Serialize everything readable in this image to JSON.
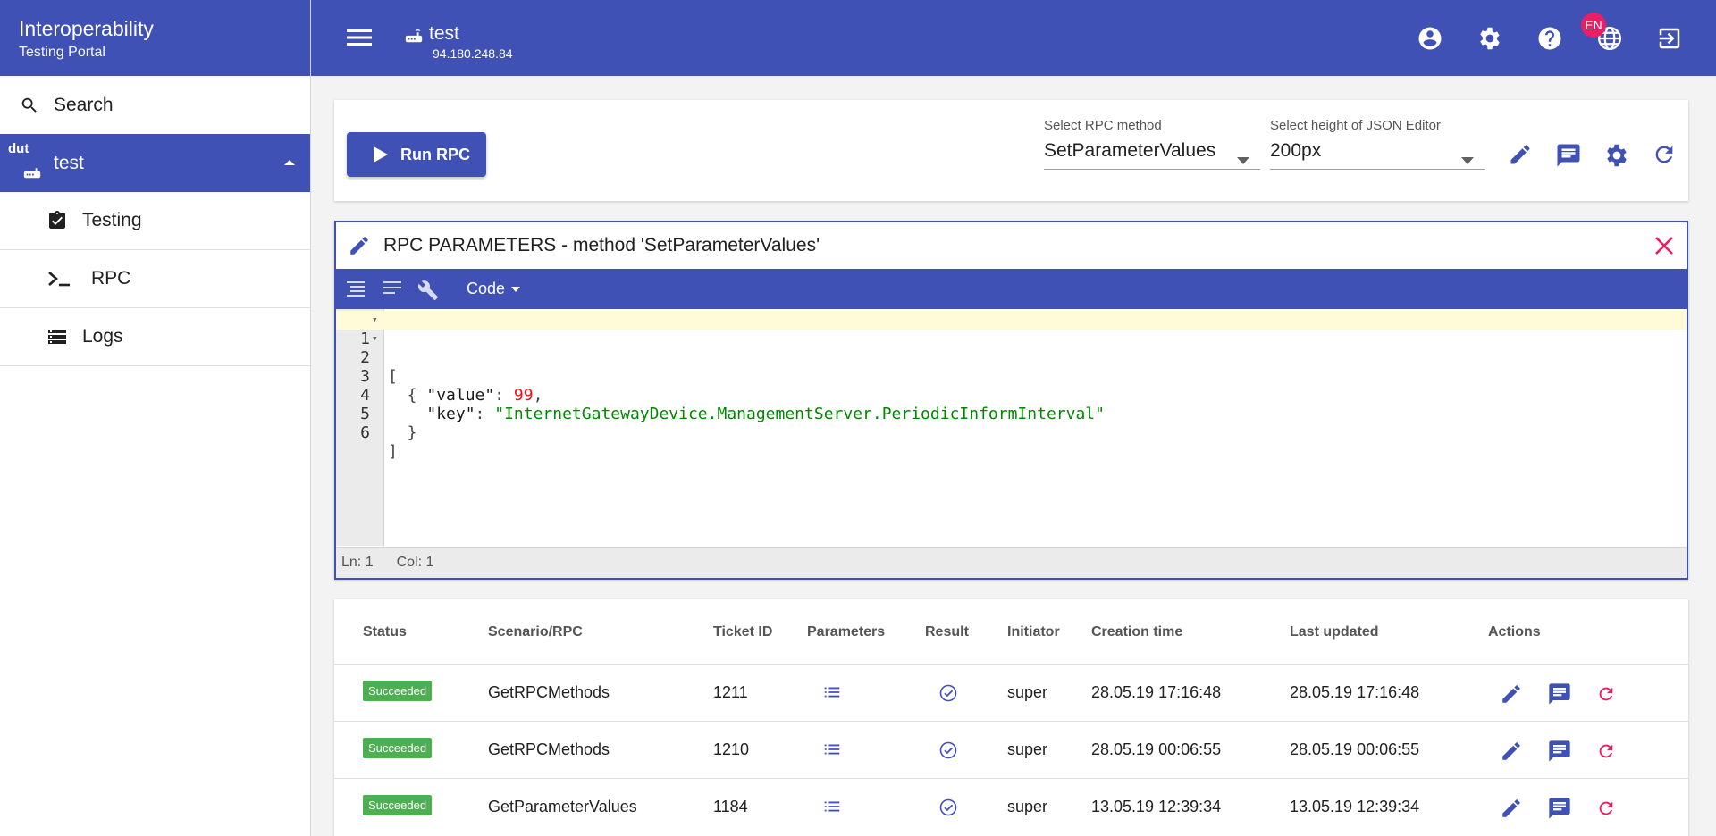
{
  "sidebar": {
    "brand_title": "Interoperability",
    "brand_subtitle": "Testing Portal",
    "search_label": "Search",
    "device_tag": "dut",
    "device_name": "test",
    "items": [
      {
        "label": "Testing",
        "icon": "clipboard-check-icon"
      },
      {
        "label": "RPC",
        "icon": "console-prompt-icon"
      },
      {
        "label": "Logs",
        "icon": "storage-icon"
      }
    ]
  },
  "header": {
    "device_name": "test",
    "device_ip": "94.180.248.84",
    "language_badge": "EN",
    "icons": [
      "account-circle-icon",
      "settings-icon",
      "help-icon",
      "globe-icon",
      "logout-icon"
    ]
  },
  "toolbar": {
    "run_label": "Run RPC",
    "rpc_method_label": "Select RPC method",
    "rpc_method_value": "SetParameterValues",
    "height_label": "Select height of JSON Editor",
    "height_value": "200px"
  },
  "editor": {
    "title": "RPC PARAMETERS - method 'SetParameterValues'",
    "mode_label": "Code",
    "lines": [
      {
        "n": "1",
        "text": "["
      },
      {
        "n": "2",
        "text": "  {"
      },
      {
        "n": "3",
        "key": "\"value\"",
        "num": "99"
      },
      {
        "n": "4",
        "key": "\"key\"",
        "str": "\"InternetGatewayDevice.ManagementServer.PeriodicInformInterval\""
      },
      {
        "n": "5",
        "text": "  }"
      },
      {
        "n": "6",
        "text": "]"
      }
    ],
    "status_ln": "Ln: 1",
    "status_col": "Col: 1"
  },
  "table": {
    "headers": [
      "Status",
      "Scenario/RPC",
      "Ticket ID",
      "Parameters",
      "Result",
      "Initiator",
      "Creation time",
      "Last updated",
      "Actions"
    ],
    "rows": [
      {
        "status": "Succeeded",
        "rpc": "GetRPCMethods",
        "ticket": "1211",
        "initiator": "super",
        "created": "28.05.19 17:16:48",
        "updated": "28.05.19 17:16:48"
      },
      {
        "status": "Succeeded",
        "rpc": "GetRPCMethods",
        "ticket": "1210",
        "initiator": "super",
        "created": "28.05.19 00:06:55",
        "updated": "28.05.19 00:06:55"
      },
      {
        "status": "Succeeded",
        "rpc": "GetParameterValues",
        "ticket": "1184",
        "initiator": "super",
        "created": "13.05.19 12:39:34",
        "updated": "13.05.19 12:39:34"
      }
    ]
  },
  "colors": {
    "primary": "#3f51b5",
    "accent": "#e91e63",
    "success": "#4caf50"
  }
}
